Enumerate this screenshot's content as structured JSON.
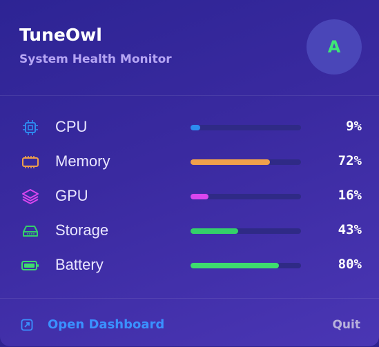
{
  "header": {
    "app_name": "TuneOwl",
    "subtitle": "System Health Monitor",
    "avatar_letter": "A"
  },
  "metrics": [
    {
      "name": "cpu",
      "label": "CPU",
      "value_text": "9%",
      "percent": 9,
      "color": "#2d8cf0",
      "icon": "cpu-chip-icon"
    },
    {
      "name": "memory",
      "label": "Memory",
      "value_text": "72%",
      "percent": 72,
      "color": "#f0a04b",
      "icon": "memory-module-icon"
    },
    {
      "name": "gpu",
      "label": "GPU",
      "value_text": "16%",
      "percent": 16,
      "color": "#d946ef",
      "icon": "layers-icon"
    },
    {
      "name": "storage",
      "label": "Storage",
      "value_text": "43%",
      "percent": 43,
      "color": "#34d06a",
      "icon": "hard-drive-icon"
    },
    {
      "name": "battery",
      "label": "Battery",
      "value_text": "80%",
      "percent": 80,
      "color": "#3edc6e",
      "icon": "battery-icon"
    }
  ],
  "footer": {
    "dashboard_label": "Open Dashboard",
    "quit_label": "Quit",
    "link_color": "#3a91ff"
  }
}
